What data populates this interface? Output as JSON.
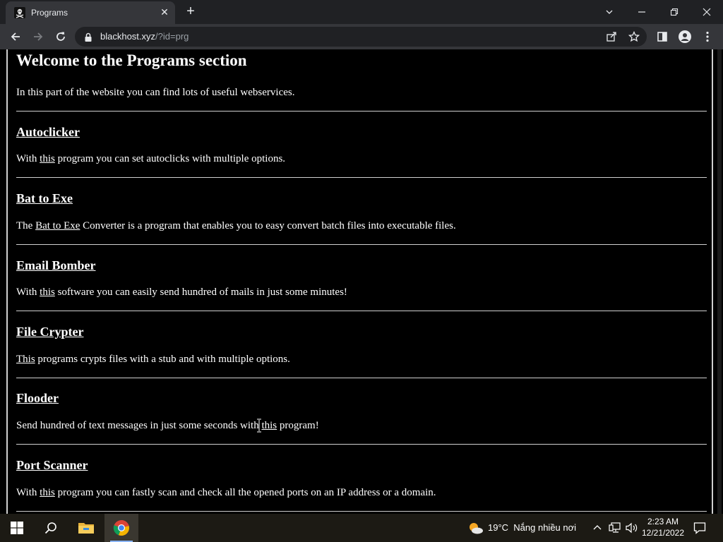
{
  "browser": {
    "tab": {
      "title": "Programs"
    },
    "url": {
      "host": "blackhost.xyz",
      "path": "/?id=prg"
    }
  },
  "page": {
    "title": "Welcome to the Programs section",
    "intro": "In this part of the website you can find lots of useful webservices.",
    "sections": [
      {
        "title": "Autoclicker",
        "desc_before": "With ",
        "desc_link": "this",
        "desc_after": " program you can set autoclicks with multiple options."
      },
      {
        "title": "Bat to Exe",
        "desc_before": "The ",
        "desc_link": "Bat to Exe",
        "desc_after": " Converter is a program that enables you to easy convert batch files into executable files."
      },
      {
        "title": "Email Bomber",
        "desc_before": "With ",
        "desc_link": "this",
        "desc_after": " software you can easily send hundred of mails in just some minutes!"
      },
      {
        "title": "File Crypter",
        "desc_before": "",
        "desc_link": "This",
        "desc_after": " programs crypts files with a stub and with multiple options."
      },
      {
        "title": "Flooder",
        "desc_before": "Send hundred of text messages in just some seconds with ",
        "desc_link": "this",
        "desc_after": " program!"
      },
      {
        "title": "Port Scanner",
        "desc_before": "With ",
        "desc_link": "this",
        "desc_after": " program you can fastly scan and check all the opened ports on an IP address or a domain."
      }
    ]
  },
  "taskbar": {
    "weather": {
      "temp": "19°C",
      "desc": "Nắng nhiều nơi"
    },
    "clock": {
      "time": "2:23 AM",
      "date": "12/21/2022"
    }
  },
  "colors": {
    "page_bg": "#000000",
    "text": "#ffffff",
    "chrome_dark": "#202124",
    "chrome_toolbar": "#35363a"
  },
  "icons": [
    "pirate-flag-favicon",
    "close-icon",
    "plus-icon",
    "chevron-down-icon",
    "minimize-icon",
    "restore-icon",
    "back-arrow-icon",
    "forward-arrow-icon",
    "reload-icon",
    "lock-icon",
    "share-icon",
    "star-icon",
    "side-panel-icon",
    "profile-icon",
    "kebab-menu-icon",
    "windows-start-icon",
    "search-icon",
    "folder-icon",
    "chrome-icon",
    "weather-sun-cloud-icon",
    "chevron-up-icon",
    "network-icon",
    "speaker-icon",
    "notification-icon"
  ]
}
